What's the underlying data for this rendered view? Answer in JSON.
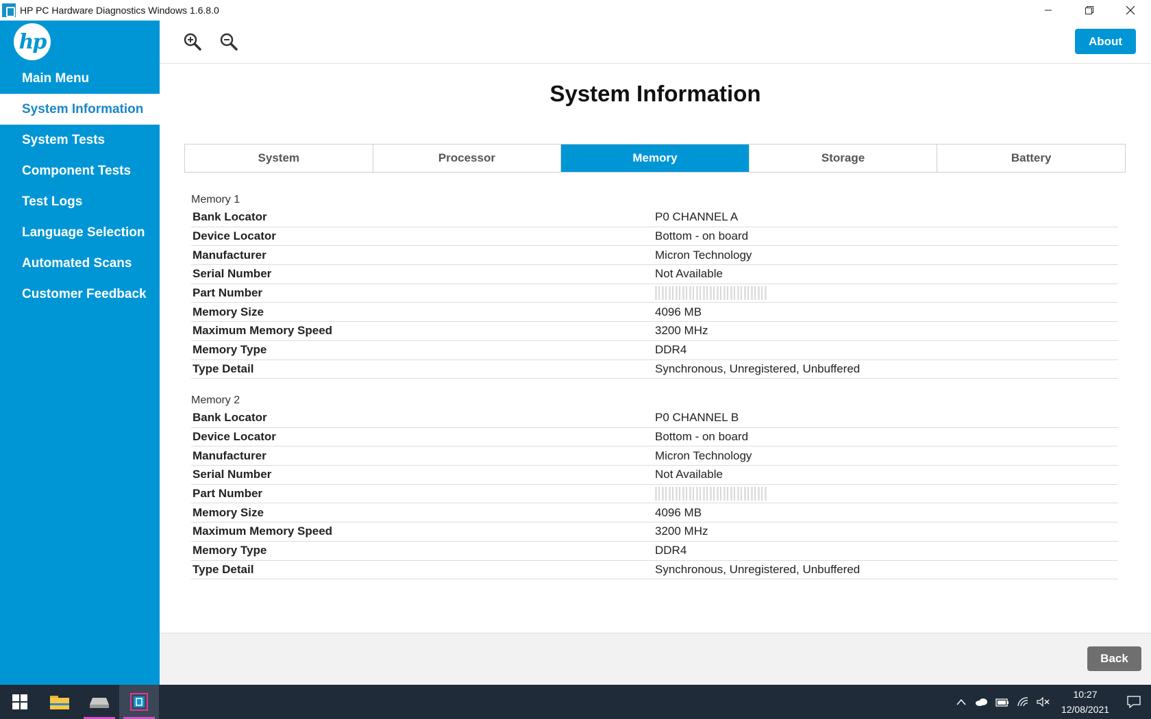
{
  "window": {
    "title": "HP PC Hardware Diagnostics Windows 1.6.8.0",
    "minimize_glyph": "—",
    "restore_glyph": "❐",
    "close_glyph": "✕"
  },
  "sidebar": {
    "logo_text": "hp",
    "items": [
      {
        "label": "Main Menu"
      },
      {
        "label": "System Information"
      },
      {
        "label": "System Tests"
      },
      {
        "label": "Component Tests"
      },
      {
        "label": "Test Logs"
      },
      {
        "label": "Language Selection"
      },
      {
        "label": "Automated Scans"
      },
      {
        "label": "Customer Feedback"
      }
    ],
    "active_index": 1
  },
  "header": {
    "zoom_in_icon": "zoom-in-icon",
    "zoom_out_icon": "zoom-out-icon",
    "about_label": "About"
  },
  "page": {
    "title": "System Information",
    "tabs": [
      {
        "label": "System"
      },
      {
        "label": "Processor"
      },
      {
        "label": "Memory"
      },
      {
        "label": "Storage"
      },
      {
        "label": "Battery"
      }
    ],
    "active_tab": "Memory"
  },
  "memory": [
    {
      "title": "Memory 1",
      "rows": [
        {
          "label": "Bank Locator",
          "value": "P0 CHANNEL A"
        },
        {
          "label": "Device Locator",
          "value": "Bottom - on board"
        },
        {
          "label": "Manufacturer",
          "value": "Micron Technology"
        },
        {
          "label": "Serial Number",
          "value": "Not Available"
        },
        {
          "label": "Part Number",
          "value": "",
          "redacted": true
        },
        {
          "label": "Memory Size",
          "value": "4096 MB"
        },
        {
          "label": "Maximum Memory Speed",
          "value": "3200 MHz"
        },
        {
          "label": "Memory Type",
          "value": "DDR4"
        },
        {
          "label": "Type Detail",
          "value": "Synchronous, Unregistered, Unbuffered"
        }
      ]
    },
    {
      "title": "Memory 2",
      "rows": [
        {
          "label": "Bank Locator",
          "value": "P0 CHANNEL B"
        },
        {
          "label": "Device Locator",
          "value": "Bottom - on board"
        },
        {
          "label": "Manufacturer",
          "value": "Micron Technology"
        },
        {
          "label": "Serial Number",
          "value": "Not Available"
        },
        {
          "label": "Part Number",
          "value": "",
          "redacted": true
        },
        {
          "label": "Memory Size",
          "value": "4096 MB"
        },
        {
          "label": "Maximum Memory Speed",
          "value": "3200 MHz"
        },
        {
          "label": "Memory Type",
          "value": "DDR4"
        },
        {
          "label": "Type Detail",
          "value": "Synchronous, Unregistered, Unbuffered"
        }
      ]
    }
  ],
  "footer": {
    "back_label": "Back"
  },
  "taskbar": {
    "time": "10:27",
    "date": "12/08/2021",
    "apps": [
      "windows-start-icon",
      "file-explorer-icon",
      "drive-icon",
      "hp-diagnostics-icon"
    ],
    "tray_icons": [
      "chevron-up-icon",
      "cloud-icon",
      "battery-icon",
      "wifi-icon",
      "speaker-muted-icon"
    ]
  },
  "colors": {
    "accent": "#0096d6",
    "back_button": "#6f6f6f",
    "taskbar": "#1f2b38"
  }
}
